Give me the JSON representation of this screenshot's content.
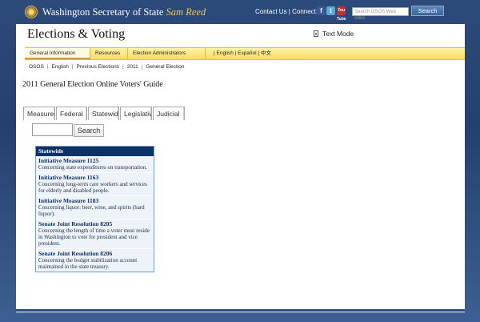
{
  "header": {
    "site_title_prefix": "Washington Secretary of State",
    "site_title_name": "Sam Reed",
    "contact_text": "Contact Us | Connect:",
    "social_icons": [
      "facebook-icon",
      "twitter-icon",
      "youtube-icon"
    ],
    "youtube_label": "You Tube",
    "search_placeholder": "Search OSOS Web Sites",
    "search_button": "Search"
  },
  "section": {
    "title": "Elections & Voting",
    "text_mode": "Text Mode"
  },
  "nav": {
    "items": [
      "General Information",
      "Resources",
      "Election Administrators"
    ],
    "languages": "|  English  |  Español  |  中文"
  },
  "breadcrumb": [
    "OSOS",
    "English",
    "Previous Elections",
    "2011",
    "General Election"
  ],
  "guide": {
    "title": "2011 General Election Online Voters' Guide",
    "tabs": [
      "Measures",
      "Federal",
      "Statewide",
      "Legislative",
      "Judicial"
    ],
    "search_button": "Search"
  },
  "statewide": {
    "header": "Statewide",
    "measures": [
      {
        "title": "Initiative Measure 1125",
        "desc": "Concerning state expenditures on transportation."
      },
      {
        "title": "Initiative Measure 1163",
        "desc": "Concerning long-term care workers and services for elderly and disabled people."
      },
      {
        "title": "Initiative Measure 1183",
        "desc": "Concerning liquor: beer, wine, and spirits (hard liquor)."
      },
      {
        "title": "Senate Joint Resolution 8205",
        "desc": "Concerning the length of time a voter must reside in Washington to vote for president and vice president."
      },
      {
        "title": "Senate Joint Resolution 8206",
        "desc": "Concerning the budget stabilization account maintained in the state treasury."
      }
    ]
  },
  "colors": {
    "header_blue": "#24406e",
    "nav_yellow": "#f8dc62",
    "list_header": "#0d3268",
    "accent_gold": "#e8c66a"
  }
}
